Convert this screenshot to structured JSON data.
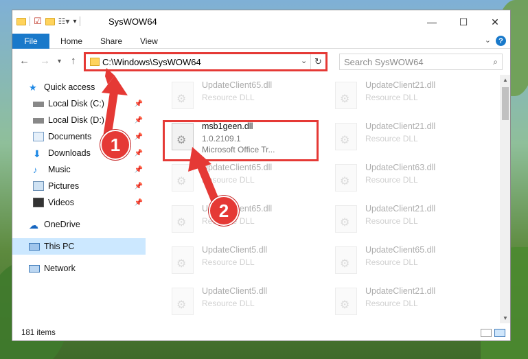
{
  "window": {
    "title": "SysWOW64",
    "minimize": "—",
    "maximize": "☐",
    "close": "✕"
  },
  "ribbon": {
    "tabs": [
      "File",
      "Home",
      "Share",
      "View"
    ],
    "help": "?"
  },
  "nav": {
    "address": "C:\\Windows\\SysWOW64",
    "search_placeholder": "Search SysWOW64"
  },
  "sidebar": {
    "items": [
      {
        "label": "Quick access",
        "icon": "star-icon"
      },
      {
        "label": "Local Disk (C:)",
        "icon": "drive-icon",
        "pinned": true
      },
      {
        "label": "Local Disk (D:)",
        "icon": "drive-icon",
        "pinned": true
      },
      {
        "label": "Documents",
        "icon": "documents-icon",
        "pinned": true
      },
      {
        "label": "Downloads",
        "icon": "download-icon",
        "pinned": true
      },
      {
        "label": "Music",
        "icon": "music-icon",
        "pinned": true
      },
      {
        "label": "Pictures",
        "icon": "pictures-icon",
        "pinned": true
      },
      {
        "label": "Videos",
        "icon": "videos-icon",
        "pinned": true
      },
      {
        "label": "OneDrive",
        "icon": "cloud-icon"
      },
      {
        "label": "This PC",
        "icon": "computer-icon",
        "selected": true
      },
      {
        "label": "Network",
        "icon": "network-icon"
      }
    ]
  },
  "files": {
    "col1": [
      {
        "name": "UpdateClient65.dll",
        "desc": "Resource DLL"
      },
      {
        "name": "msb1geen.dll",
        "version": "1.0.2109.1",
        "company": "Microsoft Office Tr..."
      },
      {
        "name": "UpdateClient65.dll",
        "desc": "Resource DLL"
      },
      {
        "name": "UpdateClient65.dll",
        "desc": "Resource DLL"
      },
      {
        "name": "UpdateClient5.dll",
        "desc": "Resource DLL"
      },
      {
        "name": "UpdateClient5.dll",
        "desc": "Resource DLL"
      }
    ],
    "col2": [
      {
        "name": "UpdateClient21.dll",
        "desc": "Resource DLL"
      },
      {
        "name": "UpdateClient21.dll",
        "desc": "Resource DLL"
      },
      {
        "name": "UpdateClient63.dll",
        "desc": "Resource DLL"
      },
      {
        "name": "UpdateClient21.dll",
        "desc": "Resource DLL"
      },
      {
        "name": "UpdateClient65.dll",
        "desc": "Resource DLL"
      },
      {
        "name": "UpdateClient21.dll",
        "desc": "Resource DLL"
      }
    ]
  },
  "status": {
    "items_count": "181 items"
  },
  "annotations": {
    "step1": "1",
    "step2": "2",
    "color": "#e53935"
  }
}
